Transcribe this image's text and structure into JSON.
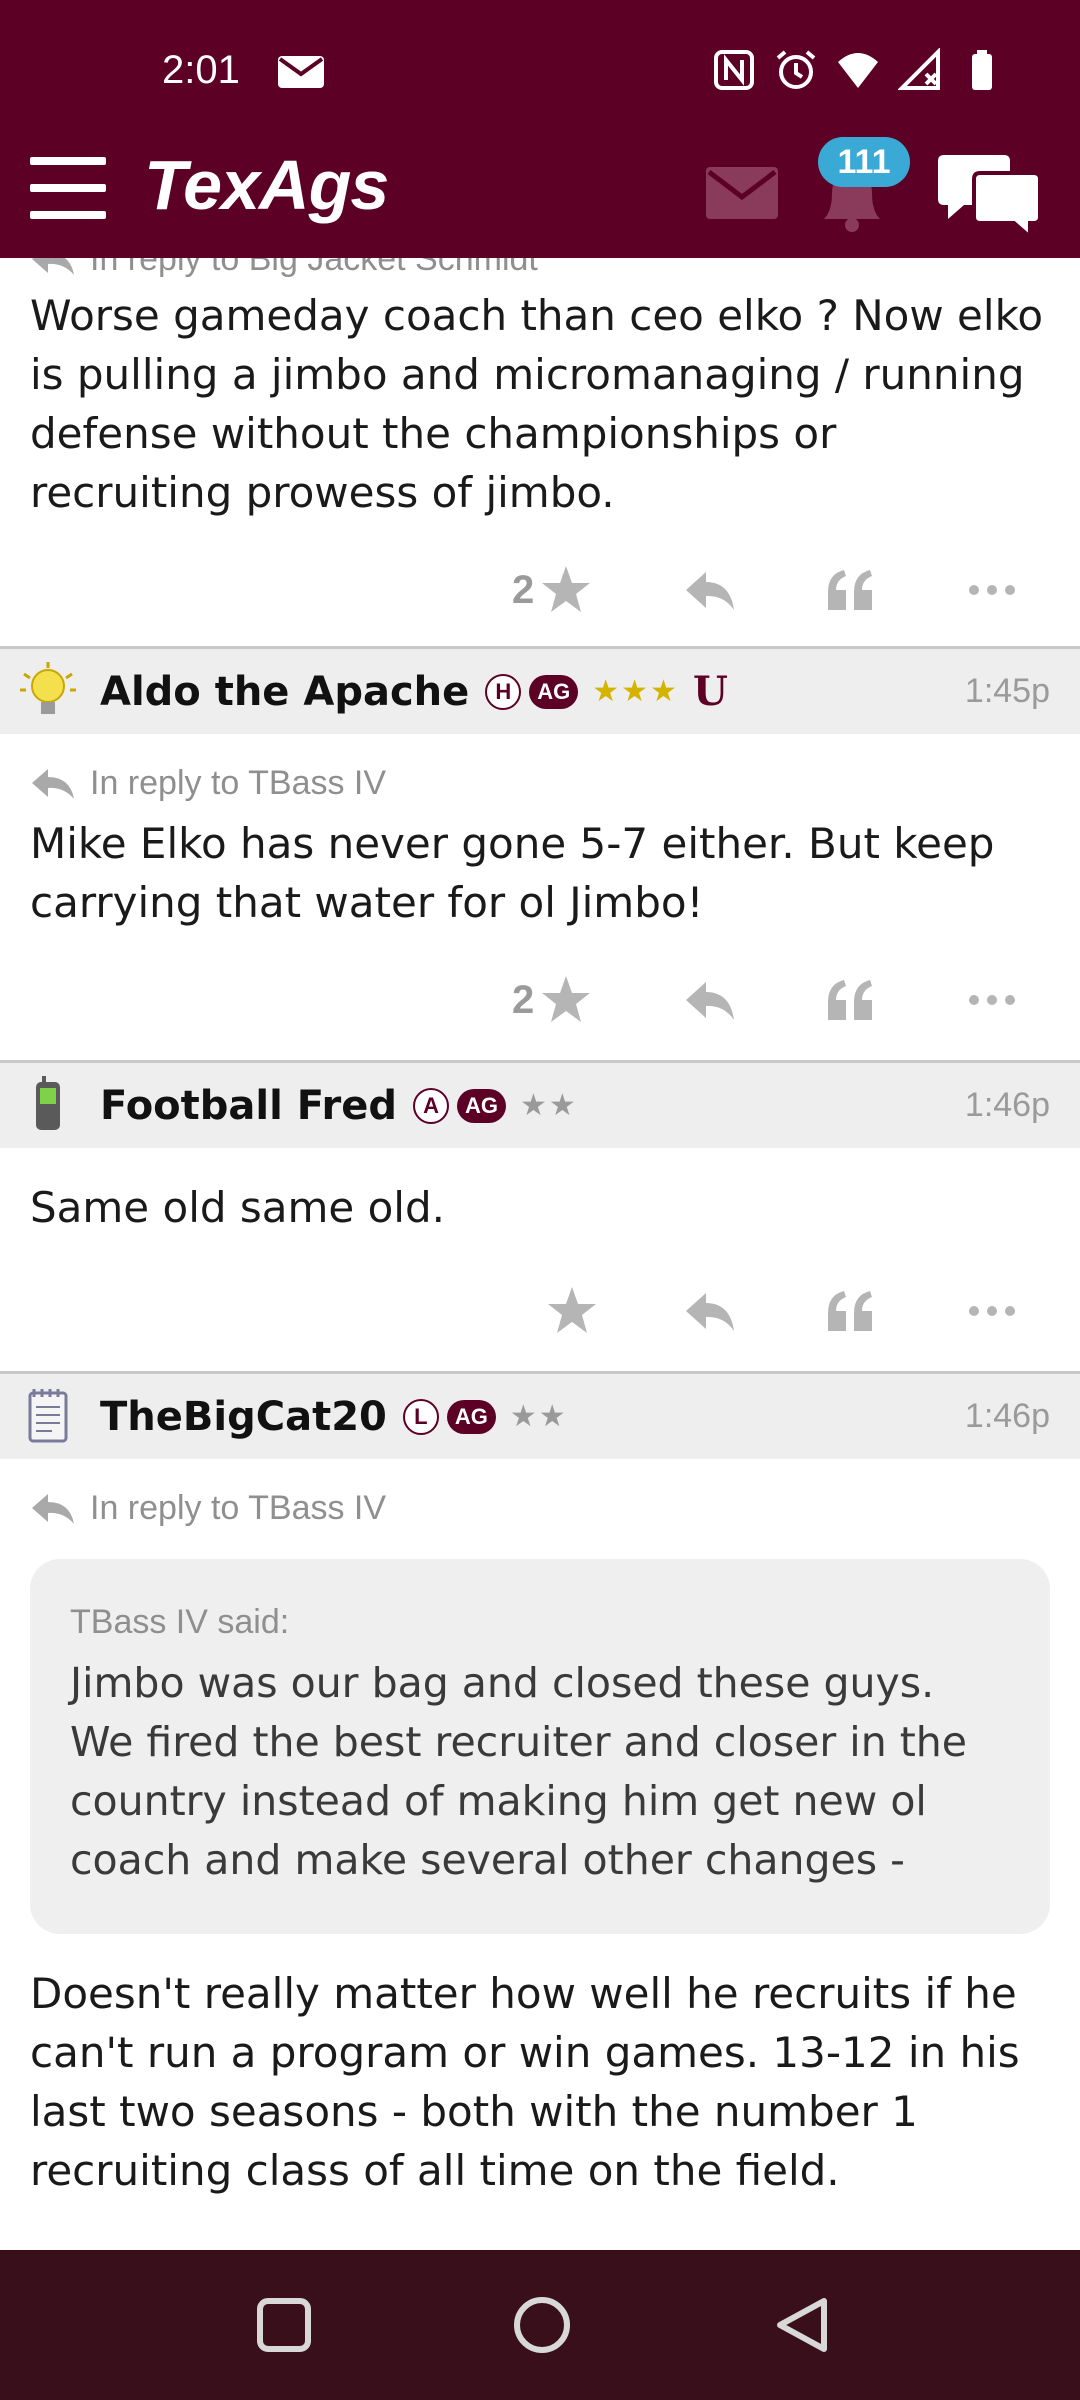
{
  "status_bar": {
    "time": "2:01",
    "icons": [
      "mail-icon",
      "nfc-icon",
      "alarm-icon",
      "wifi-icon",
      "signal-icon",
      "battery-icon"
    ]
  },
  "header": {
    "logo": "TexAgs",
    "notification_count": "111",
    "brand_color": "#5c0025"
  },
  "posts": [
    {
      "reply_to": "In reply to Big Jacket Schmidt",
      "body": "Worse gameday coach than ceo elko ? Now elko is pulling a jimbo and micromanaging / running defense without the championships or recruiting prowess of jimbo.",
      "star_count": "2"
    },
    {
      "username": "Aldo the Apache",
      "badge_letter": "H",
      "ag_badge": "AG",
      "stars": "★★★",
      "extra_badge": "U",
      "time": "1:45p",
      "reply_to": "In reply to TBass IV",
      "body": "Mike Elko has never gone 5-7 either. But keep carrying that water for ol Jimbo!",
      "star_count": "2"
    },
    {
      "username": "Football Fred",
      "badge_letter": "A",
      "ag_badge": "AG",
      "stars": "★★",
      "time": "1:46p",
      "body": "Same old same old.",
      "star_count": ""
    },
    {
      "username": "TheBigCat20",
      "badge_letter": "L",
      "ag_badge": "AG",
      "stars": "★★",
      "time": "1:46p",
      "reply_to": "In reply to TBass IV",
      "quote_author": "TBass IV said:",
      "quote_text": "Jimbo was our bag and closed these guys. We fired the best recruiter and closer in the country instead of making him get new ol coach and make several other changes -",
      "body": "Doesn't really matter how well he recruits if he can't run a program or win games. 13-12 in his last two seasons - both with the number 1 recruiting class of all time on the field."
    }
  ]
}
